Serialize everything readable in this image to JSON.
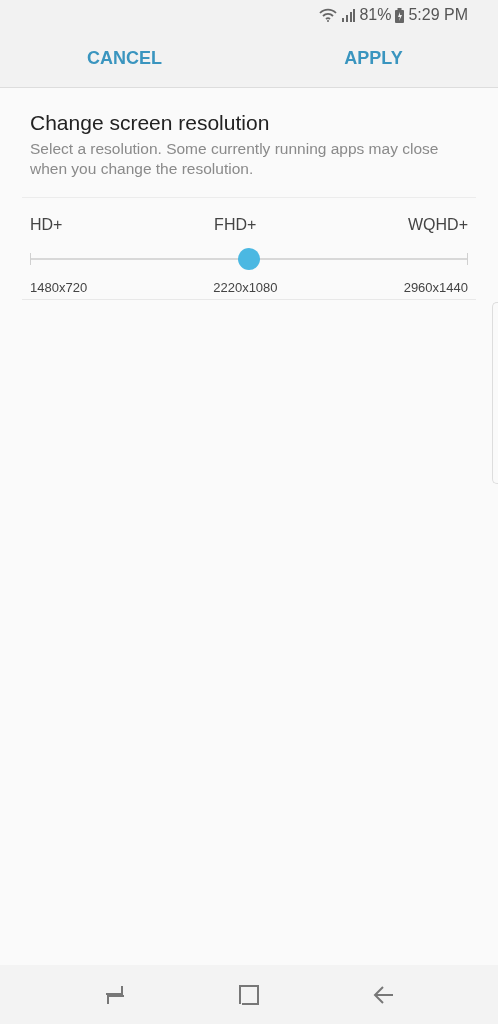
{
  "status_bar": {
    "battery": "81%",
    "time": "5:29 PM"
  },
  "header": {
    "buttons": [
      "CANCEL",
      "APPLY"
    ]
  },
  "title": "Change screen resolution",
  "description": "Select a resolution. Some currently running apps may close when you change the resolution.",
  "slider": {
    "level": 0.5,
    "stops": [
      {
        "name": "HD+",
        "resolution": "1480x720"
      },
      {
        "name": "FHD+",
        "resolution": "2220x1080"
      },
      {
        "name": "WQHD+",
        "resolution": "2960x1440"
      }
    ]
  }
}
